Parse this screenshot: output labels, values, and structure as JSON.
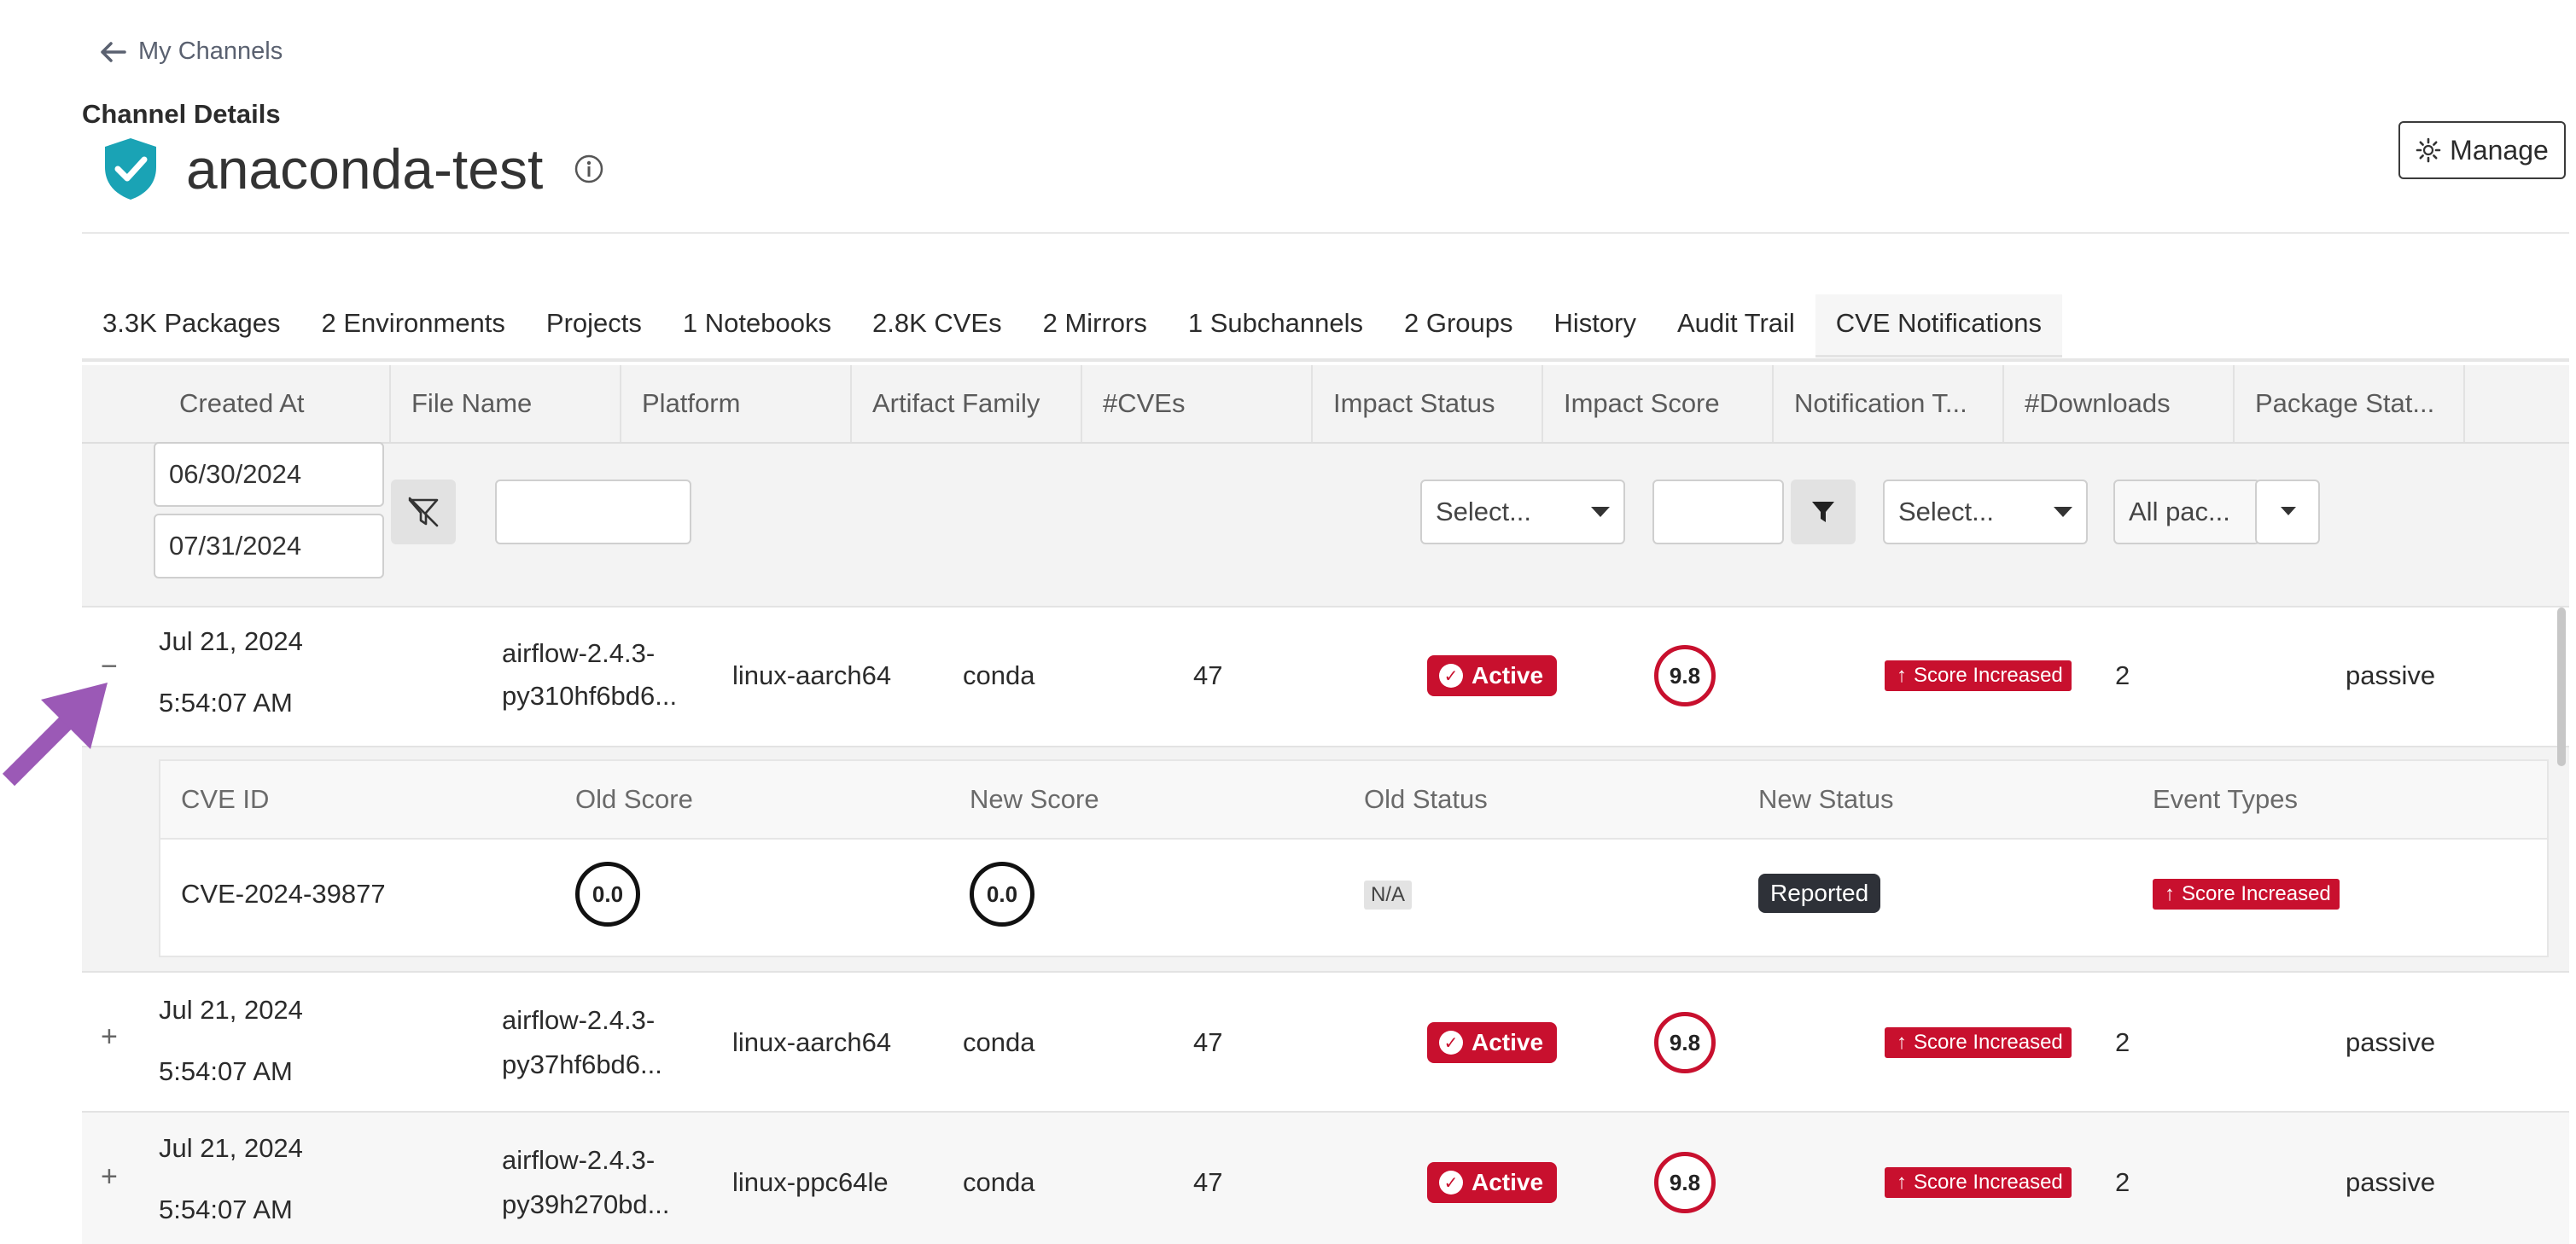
{
  "nav": {
    "back_label": "My Channels"
  },
  "header": {
    "section_label": "Channel Details",
    "channel_name": "anaconda-test",
    "manage_label": "Manage"
  },
  "tabs": [
    {
      "label": "3.3K  Packages"
    },
    {
      "label": "2  Environments"
    },
    {
      "label": "Projects"
    },
    {
      "label": "1  Notebooks"
    },
    {
      "label": "2.8K  CVEs"
    },
    {
      "label": "2  Mirrors"
    },
    {
      "label": "1  Subchannels"
    },
    {
      "label": "2  Groups"
    },
    {
      "label": "History"
    },
    {
      "label": "Audit Trail"
    },
    {
      "label": "CVE Notifications",
      "active": true
    }
  ],
  "table": {
    "columns": [
      "Created At",
      "File Name",
      "Platform",
      "Artifact Family",
      "#CVEs",
      "Impact Status",
      "Impact Score",
      "Notification T...",
      "#Downloads",
      "Package Stat..."
    ],
    "filters": {
      "date_from": "06/30/2024",
      "date_to": "07/31/2024",
      "impact_status_placeholder": "Select...",
      "notification_type_placeholder": "Select...",
      "package_status_value": "All pac..."
    },
    "rows": [
      {
        "toggle": "−",
        "date": "Jul 21, 2024",
        "time": "5:54:07 AM",
        "file_line1": "airflow-2.4.3-",
        "file_line2": "py310hf6bd6...",
        "platform": "linux-aarch64",
        "family": "conda",
        "cves": "47",
        "status": "Active",
        "score": "9.8",
        "notification": "Score Increased",
        "downloads": "2",
        "package_status": "passive"
      },
      {
        "toggle": "+",
        "date": "Jul 21, 2024",
        "time": "5:54:07 AM",
        "file_line1": "airflow-2.4.3-",
        "file_line2": "py37hf6bd6...",
        "platform": "linux-aarch64",
        "family": "conda",
        "cves": "47",
        "status": "Active",
        "score": "9.8",
        "notification": "Score Increased",
        "downloads": "2",
        "package_status": "passive"
      },
      {
        "toggle": "+",
        "date": "Jul 21, 2024",
        "time": "5:54:07 AM",
        "file_line1": "airflow-2.4.3-",
        "file_line2": "py39h270bd...",
        "platform": "linux-ppc64le",
        "family": "conda",
        "cves": "47",
        "status": "Active",
        "score": "9.8",
        "notification": "Score Increased",
        "downloads": "2",
        "package_status": "passive"
      }
    ],
    "detail": {
      "columns": [
        "CVE ID",
        "Old Score",
        "New Score",
        "Old Status",
        "New Status",
        "Event Types"
      ],
      "row": {
        "cve_id": "CVE-2024-39877",
        "old_score": "0.0",
        "new_score": "0.0",
        "old_status": "N/A",
        "new_status": "Reported",
        "event_type": "Score Increased"
      }
    }
  },
  "colors": {
    "accent_red": "#c8102e",
    "shield_teal": "#1aa3b5",
    "annotation_arrow": "#9b59b6"
  }
}
